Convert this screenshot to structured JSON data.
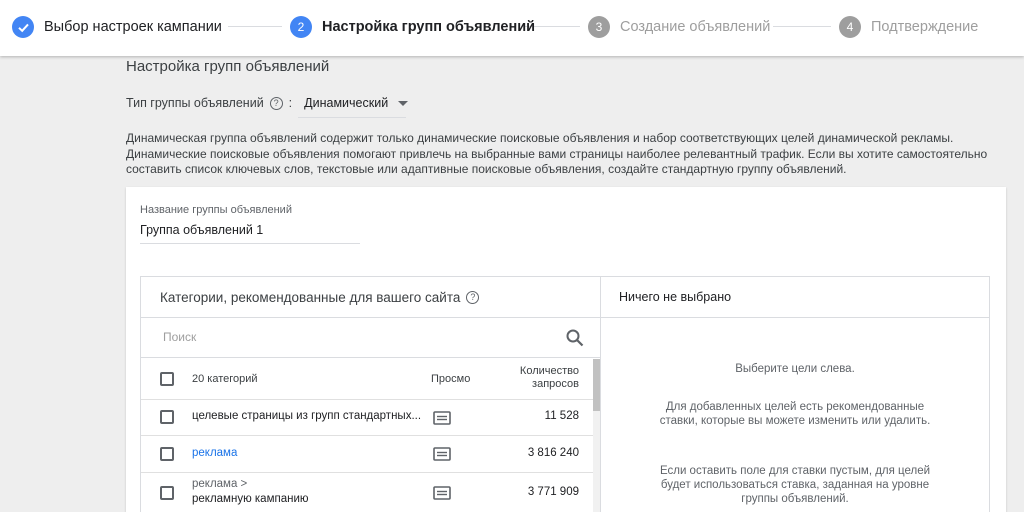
{
  "stepper": {
    "steps": [
      {
        "number": "✓",
        "label": "Выбор настроек кампании",
        "state": "done"
      },
      {
        "number": "2",
        "label": "Настройка групп объявлений",
        "state": "active"
      },
      {
        "number": "3",
        "label": "Создание объявлений",
        "state": "todo"
      },
      {
        "number": "4",
        "label": "Подтверждение",
        "state": "todo"
      }
    ]
  },
  "section": {
    "title": "Настройка групп объявлений",
    "type_label": "Тип группы объявлений",
    "help_icon": "?",
    "type_value": "Динамический",
    "description": "Динамическая группа объявлений содержит только динамические поисковые объявления и набор соответствующих целей динамической рекламы. Динамические поисковые объявления помогают привлечь на выбранные вами страницы наиболее релевантный трафик. Если вы хотите самостоятельно составить список ключевых слов, текстовые или адаптивные поисковые объявления, создайте стандартную группу объявлений."
  },
  "card": {
    "name_label": "Название группы объявлений",
    "name_value": "Группа объявлений 1",
    "left_panel": {
      "title": "Категории, рекомендованные для вашего сайта",
      "search_placeholder": "Поиск",
      "header": {
        "name": "20 категорий",
        "view": "Просмо",
        "count_line1": "Количество",
        "count_line2": "запросов"
      },
      "rows": [
        {
          "name": "целевые страницы из групп стандартных...",
          "sub": "",
          "count": "11 528",
          "is_link": false
        },
        {
          "name": "реклама",
          "sub": "",
          "count": "3 816 240",
          "is_link": true
        },
        {
          "name": "рекламную кампанию",
          "sub": "реклама >",
          "count": "3 771 909",
          "is_link": false
        }
      ]
    },
    "right_panel": {
      "title": "Ничего не выбрано",
      "hint1": "Выберите цели слева.",
      "hint2": "Для добавленных целей есть рекомендованные ставки, которые вы можете изменить или удалить.",
      "hint3": "Если оставить поле для ставки пустым, для целей будет использоваться ставка, заданная на уровне группы объявлений."
    }
  },
  "colors": {
    "accent": "#4285f4",
    "link": "#1a73e8",
    "inactive": "#9e9e9e"
  }
}
